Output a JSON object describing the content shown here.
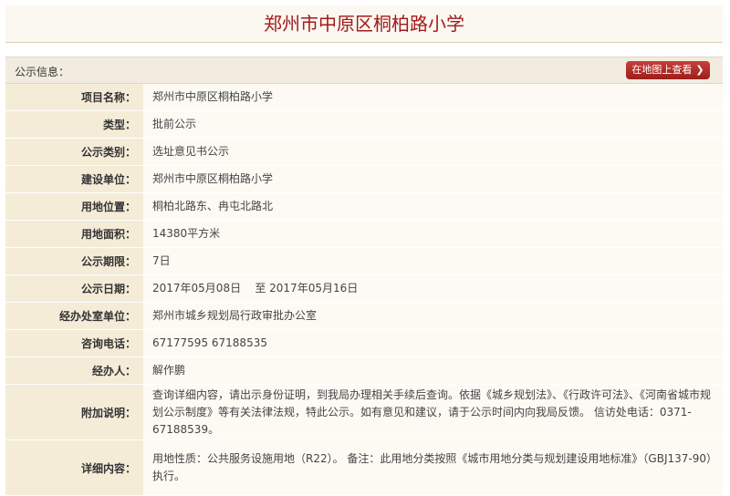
{
  "page": {
    "title": "郑州市中原区桐柏路小学"
  },
  "section": {
    "label": "公示信息：",
    "map_button": "在地图上查看",
    "map_button_icon": "chevron-right-icon"
  },
  "rows": [
    {
      "key": "项目名称：",
      "value": "郑州市中原区桐柏路小学"
    },
    {
      "key": "类型：",
      "value": "批前公示"
    },
    {
      "key": "公示类别：",
      "value": "选址意见书公示"
    },
    {
      "key": "建设单位：",
      "value": "郑州市中原区桐柏路小学"
    },
    {
      "key": "用地位置：",
      "value": "桐柏北路东、冉屯北路北"
    },
    {
      "key": "用地面积：",
      "value": "14380平方米"
    },
    {
      "key": "公示期限：",
      "value": "7日"
    },
    {
      "key": "公示日期：",
      "value": "2017年05月08日    至 2017年05月16日"
    },
    {
      "key": "经办处室单位：",
      "value": "郑州市城乡规划局行政审批办公室"
    },
    {
      "key": "咨询电话：",
      "value": "67177595 67188535"
    },
    {
      "key": "经办人：",
      "value": "解作鹏"
    },
    {
      "key": "附加说明：",
      "value": "查询详细内容，请出示身份证明，到我局办理相关手续后查询。依据《城乡规划法》、《行政许可法》、《河南省城市规划公示制度》等有关法律法规，特此公示。如有意见和建议，请于公示时间内向我局反馈。 信访处电话：0371-67188539。"
    },
    {
      "key": "详细内容：",
      "value": "用地性质：公共服务设施用地（R22）。 备注：此用地分类按照《城市用地分类与规划建设用地标准》（GBJ137-90）执行。"
    }
  ],
  "colors": {
    "title": "#a11b1b",
    "key_bg": "#f5ecd8",
    "value_bg": "#fdfaf4",
    "button": "#b0302a"
  }
}
